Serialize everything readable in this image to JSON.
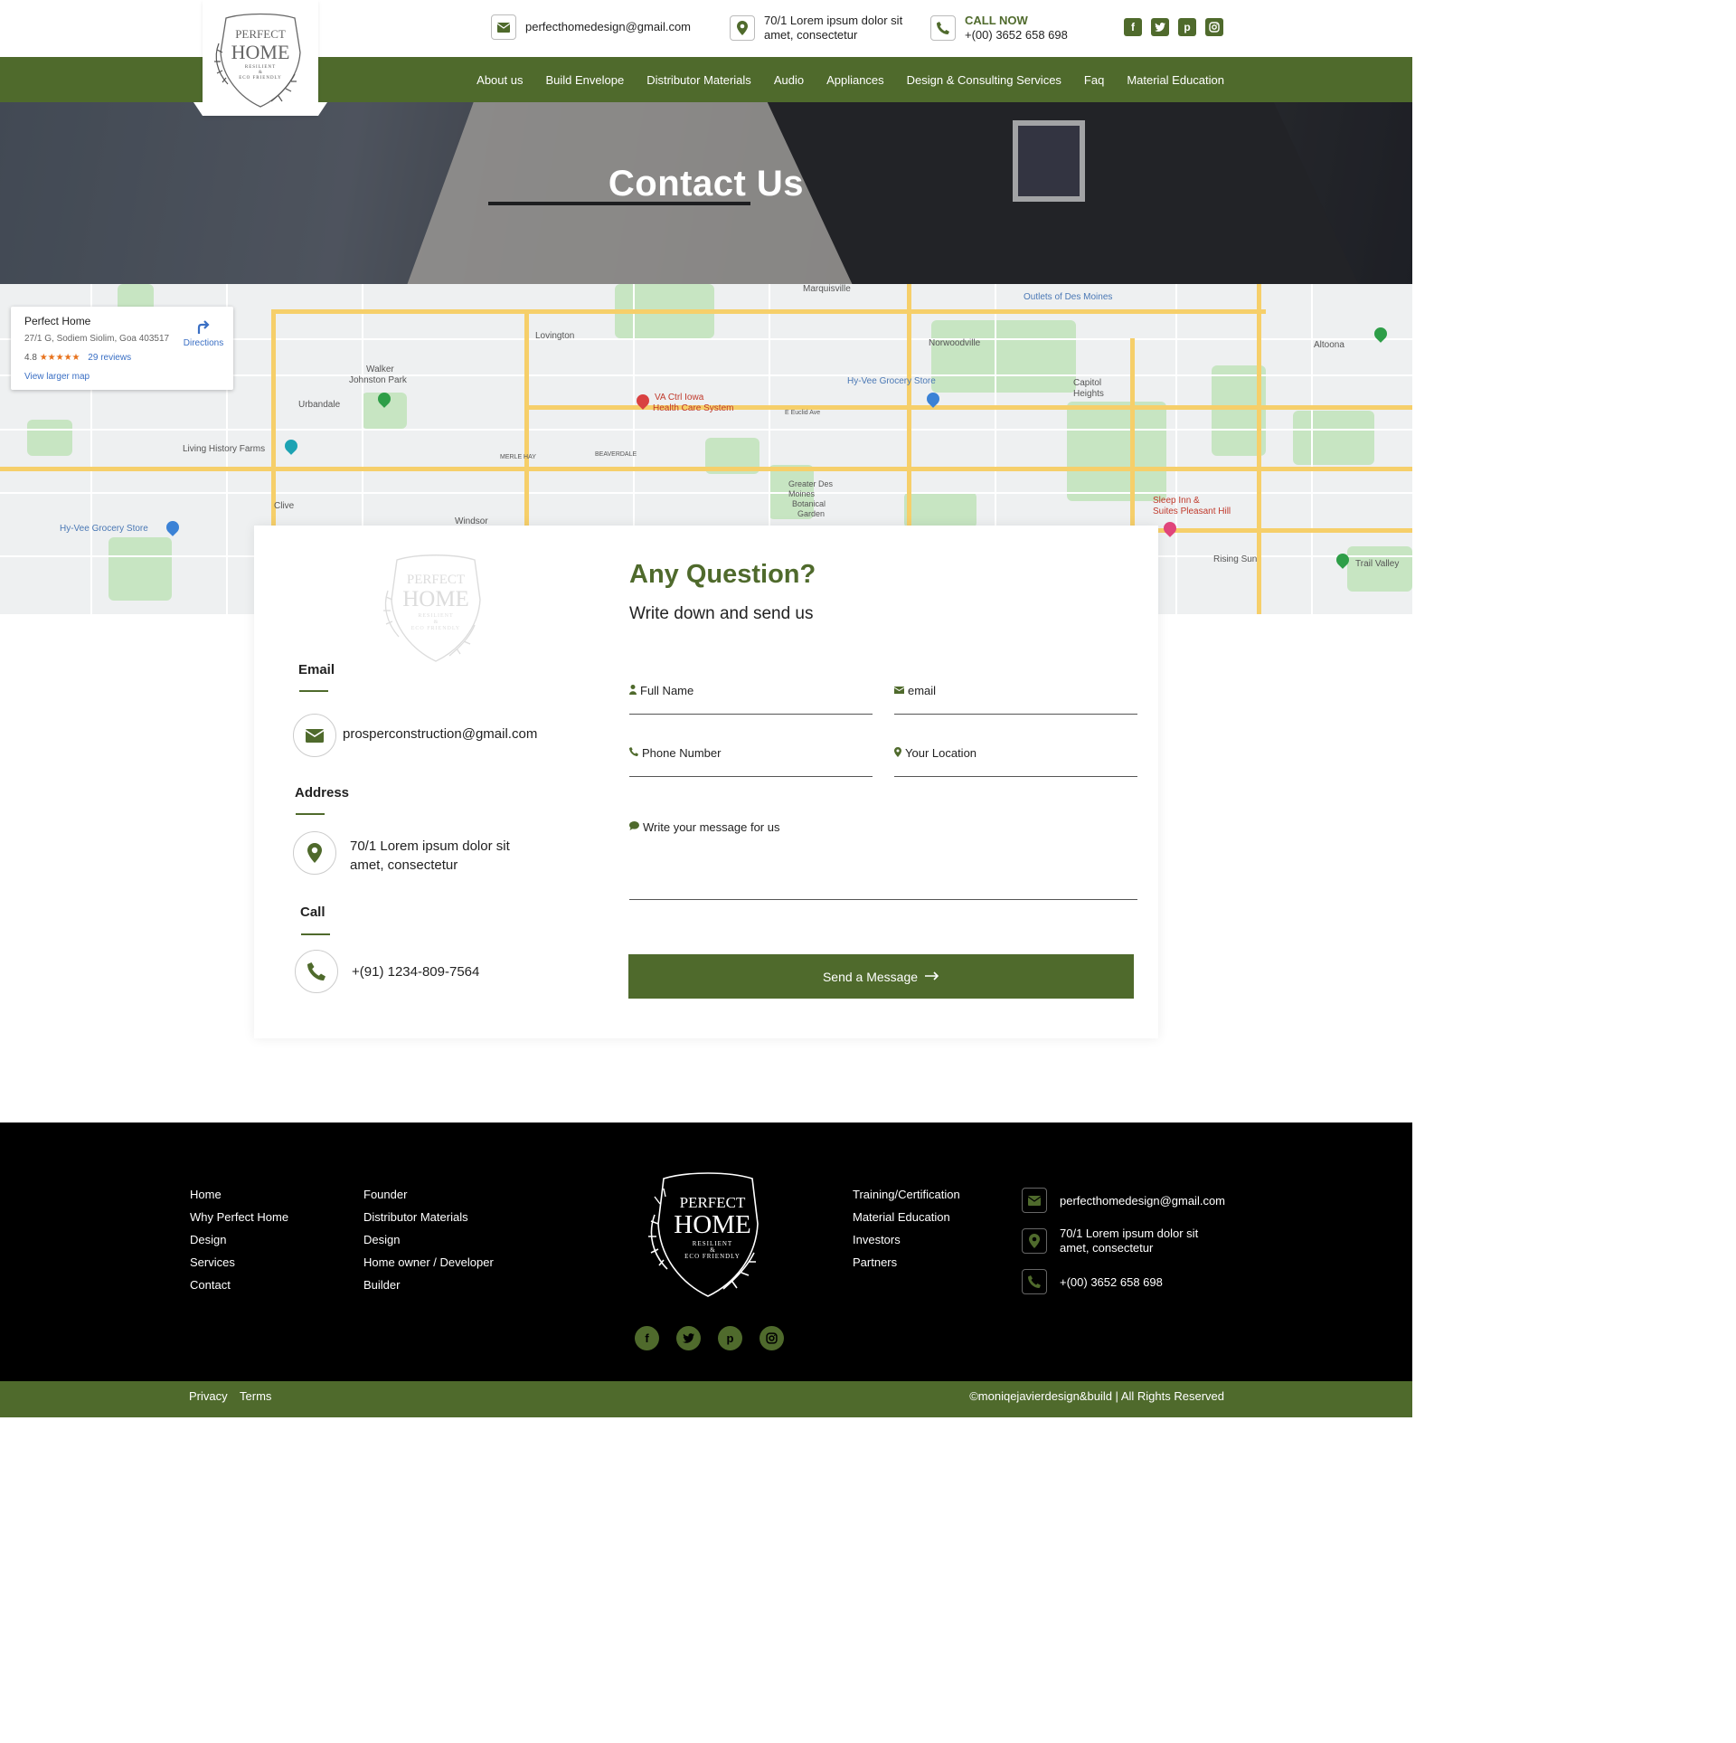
{
  "brand": {
    "logo_line1": "PERFECT",
    "logo_line2": "HOME",
    "logo_line3": "RESILIENT",
    "logo_line4": "&",
    "logo_line5": "ECO FRIENDLY"
  },
  "topbar": {
    "email": "perfecthomedesign@gmail.com",
    "address_line1": "70/1 Lorem ipsum dolor sit",
    "address_line2": "amet, consectetur",
    "call_label": "CALL NOW",
    "phone": "+(00) 3652 658 698",
    "social": [
      "facebook-icon",
      "twitter-icon",
      "pinterest-icon",
      "instagram-icon"
    ]
  },
  "nav": {
    "items": [
      {
        "label": "About us"
      },
      {
        "label": "Build Envelope"
      },
      {
        "label": "Distributor Materials"
      },
      {
        "label": "Audio"
      },
      {
        "label": "Appliances"
      },
      {
        "label": "Design & Consulting Services"
      },
      {
        "label": "Faq"
      },
      {
        "label": "Material Education"
      }
    ]
  },
  "hero": {
    "title": "Contact Us"
  },
  "map": {
    "place_name": "Perfect Home",
    "address": "27/1 G, Sodiem Siolim, Goa 403517",
    "rating": "4.8",
    "stars": "★★★★★",
    "reviews": "29 reviews",
    "directions": "Directions",
    "larger_map": "View larger map",
    "labels": {
      "marquisville": "Marquisville",
      "outlets": "Outlets of Des Moines",
      "lovington": "Lovington",
      "norwoodville": "Norwoodville",
      "altoona": "Altoona",
      "walker": "Walker",
      "johnston": "Johnston Park",
      "urbandale": "Urbandale",
      "va": "VA Ctrl Iowa",
      "va2": "Health Care System",
      "hyvee1": "Hy-Vee Grocery Store",
      "capitol": "Capitol",
      "heights": "Heights",
      "euclid": "E Euclid Ave",
      "living": "Living History Farms",
      "merle": "MERLE HAY",
      "beaverdale": "BEAVERDALE",
      "clive": "Clive",
      "windsor": "Windsor",
      "hyvee2": "Hy-Vee Grocery Store",
      "botanical1": "Greater Des",
      "botanical2": "Moines",
      "botanical3": "Botanical",
      "botanical4": "Garden",
      "sleep1": "Sleep Inn &",
      "sleep2": "Suites Pleasant Hill",
      "rising": "Rising Sun",
      "trail": "Trail Valley"
    }
  },
  "contact": {
    "email_label": "Email",
    "email_value": "prosperconstruction@gmail.com",
    "address_label": "Address",
    "address_line1": "70/1 Lorem ipsum dolor sit",
    "address_line2": "amet, consectetur",
    "call_label": "Call",
    "call_value": "+(91) 1234-809-7564",
    "form_title": "Any Question?",
    "form_subtitle": "Write down and send us",
    "fields": {
      "full_name": "Full Name",
      "email": "email",
      "phone": "Phone Number",
      "location": "Your Location",
      "message": "Write your message for us"
    },
    "send_label": "Send a Message"
  },
  "footer": {
    "col1": [
      "Home",
      "Why Perfect Home",
      "Design",
      "Services",
      "Contact"
    ],
    "col2": [
      "Founder",
      "Distributor Materials",
      "Design",
      "Home owner / Developer",
      "Builder"
    ],
    "col3": [
      "Training/Certification",
      "Material Education",
      "Investors",
      "Partners"
    ],
    "email": "perfecthomedesign@gmail.com",
    "address_line1": "70/1 Lorem ipsum dolor sit",
    "address_line2": "amet, consectetur",
    "phone": "+(00) 3652 658 698",
    "social": [
      "facebook-icon",
      "twitter-icon",
      "pinterest-icon",
      "instagram-icon"
    ],
    "privacy": "Privacy",
    "terms": "Terms",
    "copyright": "©moniqejavierdesign&build | All Rights Reserved"
  },
  "colors": {
    "brand_green": "#4f6a2c",
    "footer_bg": "#000000"
  }
}
